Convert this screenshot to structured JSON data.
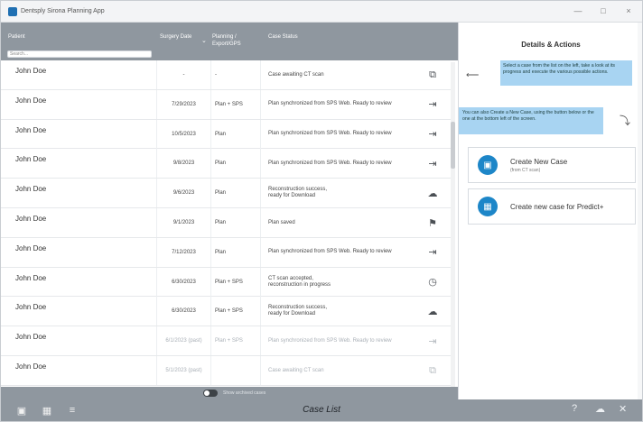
{
  "window": {
    "title": "Dentsply Sirona Planning App",
    "controls": [
      "—",
      "□",
      "×"
    ]
  },
  "table": {
    "headers": {
      "patient": "Patient",
      "surgery_date": "Surgery Date",
      "planning": "Planning / Export/GPS",
      "status": "Case Status"
    },
    "search_placeholder": "Search...",
    "sort_glyph": "⌄",
    "rows": [
      {
        "name": "John Doe",
        "date": "-",
        "plan": "-",
        "status": "Case awaiting CT scan",
        "icon": "⧉",
        "icon_name": "copy-icon",
        "faded": false
      },
      {
        "name": "John Doe",
        "date": "7/29/2023",
        "plan": "Plan + SPS",
        "status": "Plan synchronized from SPS Web. Ready to review",
        "icon": "⇥",
        "icon_name": "export-icon",
        "faded": false
      },
      {
        "name": "John Doe",
        "date": "10/5/2023",
        "plan": "Plan",
        "status": "Plan synchronized from SPS Web. Ready to review",
        "icon": "⇥",
        "icon_name": "export-icon",
        "faded": false
      },
      {
        "name": "John Doe",
        "date": "9/8/2023",
        "plan": "Plan",
        "status": "Plan synchronized from SPS Web. Ready to review",
        "icon": "⇥",
        "icon_name": "export-icon",
        "faded": false
      },
      {
        "name": "John Doe",
        "date": "9/6/2023",
        "plan": "Plan",
        "status": "Reconstruction success,\nready for Download",
        "icon": "☁",
        "icon_name": "cloud-download-icon",
        "faded": false
      },
      {
        "name": "John Doe",
        "date": "9/1/2023",
        "plan": "Plan",
        "status": "Plan saved",
        "icon": "⚑",
        "icon_name": "flag-icon",
        "faded": false
      },
      {
        "name": "John Doe",
        "date": "7/12/2023",
        "plan": "Plan",
        "status": "Plan synchronized from SPS Web. Ready to review",
        "icon": "⇥",
        "icon_name": "export-icon",
        "faded": false
      },
      {
        "name": "John Doe",
        "date": "6/30/2023",
        "plan": "Plan + SPS",
        "status": "CT scan accepted,\nreconstruction in progress",
        "icon": "◷",
        "icon_name": "clock-icon",
        "faded": false
      },
      {
        "name": "John Doe",
        "date": "6/30/2023",
        "plan": "Plan + SPS",
        "status": "Reconstruction success,\nready for Download",
        "icon": "☁",
        "icon_name": "cloud-download-icon",
        "faded": false
      },
      {
        "name": "John Doe",
        "date": "6/1/2023 (past)",
        "plan": "Plan + SPS",
        "status": "Plan synchronized from SPS Web. Ready to review",
        "icon": "⇥",
        "icon_name": "export-icon",
        "faded": true
      },
      {
        "name": "John Doe",
        "date": "5/1/2023 (past)",
        "plan": "",
        "status": "Case awaiting CT scan",
        "icon": "⧉",
        "icon_name": "copy-icon",
        "faded": true
      }
    ]
  },
  "toggle": {
    "label": "Show archived cases"
  },
  "panel": {
    "title": "Details & Actions",
    "hint_select": "Select a case from the list on the left, take a look at its progress and execute the various possible actions.",
    "hint_create": "You can also Create a New Case, using the button below or the one at the bottom left of the screen.",
    "actions": [
      {
        "label": "Create New Case",
        "sub": "(from CT scan)",
        "icon": "▣",
        "icon_name": "new-case-icon"
      },
      {
        "label": "Create new case for Predict+",
        "sub": "",
        "icon": "▦",
        "icon_name": "predict-chart-icon"
      }
    ]
  },
  "bottombar": {
    "title": "Case List",
    "left_icons": [
      {
        "glyph": "▣",
        "name": "new-case-icon"
      },
      {
        "glyph": "▦",
        "name": "chart-icon"
      },
      {
        "glyph": "≡",
        "name": "list-icon"
      }
    ],
    "right_icons": [
      {
        "glyph": "?",
        "name": "help-icon"
      },
      {
        "glyph": "☁",
        "name": "cloud-sync-icon"
      },
      {
        "glyph": "✕",
        "name": "tools-icon"
      }
    ]
  },
  "colors": {
    "header_gray": "#8f979f",
    "accent_blue": "#1d86c8",
    "hint_blue": "#a8d4f2"
  }
}
